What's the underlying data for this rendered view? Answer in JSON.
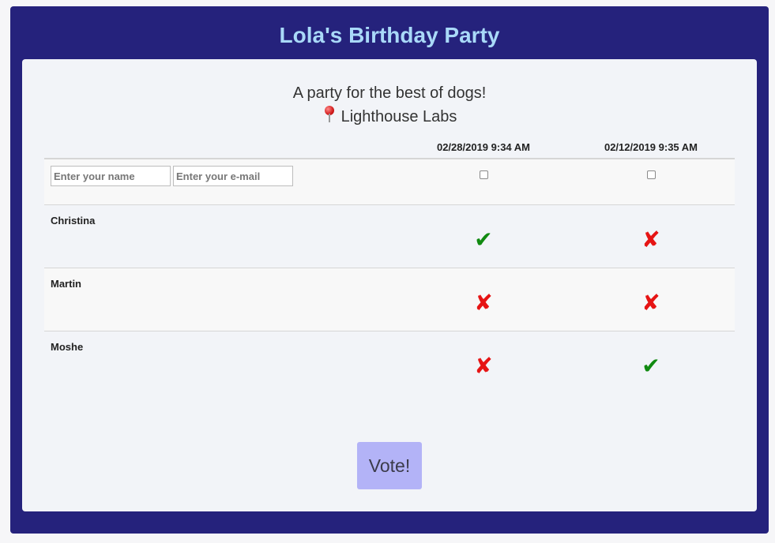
{
  "event": {
    "title": "Lola's Birthday Party",
    "description": "A party for the best of dogs!",
    "location": "Lighthouse Labs"
  },
  "form": {
    "name_placeholder": "Enter your name",
    "email_placeholder": "Enter your e-mail"
  },
  "options": [
    {
      "label": "02/28/2019 9:34 AM"
    },
    {
      "label": "02/12/2019 9:35 AM"
    }
  ],
  "voters": [
    {
      "name": "Christina",
      "votes": [
        "✔",
        "✘"
      ]
    },
    {
      "name": "Martin",
      "votes": [
        "✘",
        "✘"
      ]
    },
    {
      "name": "Moshe",
      "votes": [
        "✘",
        "✔"
      ]
    }
  ],
  "vote_button": {
    "label": "Vote!"
  },
  "icons": {
    "location": "map-pin-icon",
    "yes": "checkmark-icon",
    "no": "cross-icon"
  },
  "colors": {
    "frame": "#25227c",
    "title": "#a9d9f8",
    "yes": "#118a11",
    "no": "#e61414",
    "button": "#b3b3f7"
  }
}
